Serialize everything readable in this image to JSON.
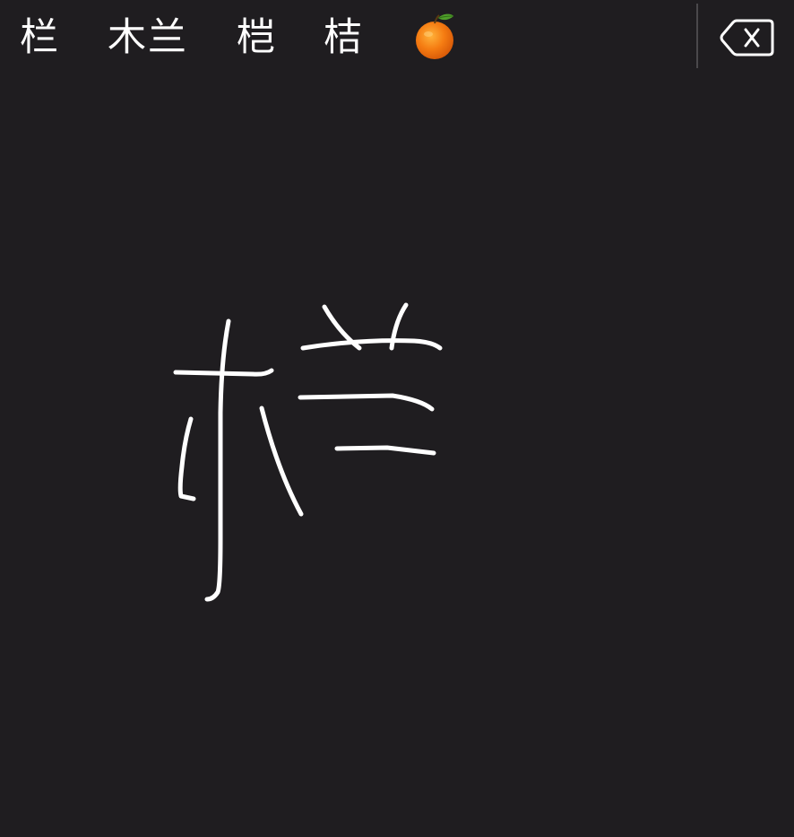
{
  "candidates": [
    {
      "text": "栏"
    },
    {
      "text": "木兰"
    },
    {
      "text": "桤"
    },
    {
      "text": "桔"
    }
  ],
  "emoji_candidate": {
    "icon": "orange-emoji-icon"
  },
  "delete_key": {
    "icon": "backspace-icon"
  },
  "colors": {
    "background": "#1f1d20",
    "ink": "#ffffff",
    "divider": "#4a484b"
  }
}
